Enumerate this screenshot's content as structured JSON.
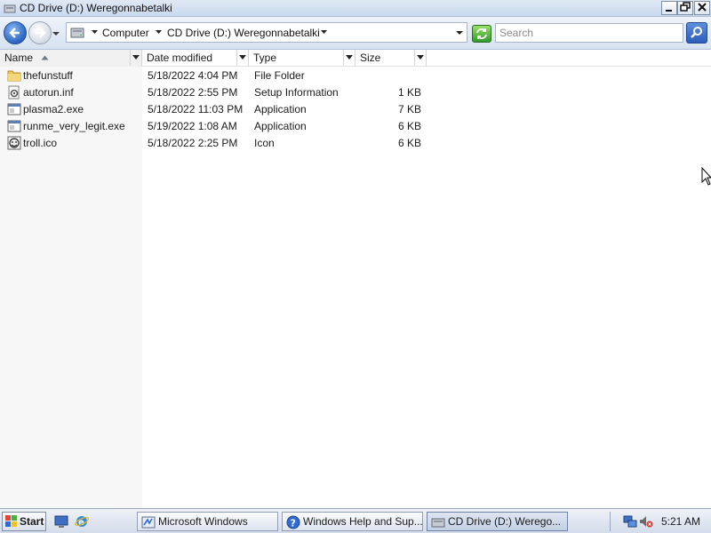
{
  "window": {
    "title": "CD Drive (D:) Weregonnabetalki"
  },
  "address_bar": {
    "crumbs": [
      "Computer",
      "CD Drive (D:) Weregonnabetalki"
    ]
  },
  "search": {
    "placeholder": "Search"
  },
  "columns": {
    "name": "Name",
    "date_modified": "Date modified",
    "type": "Type",
    "size": "Size"
  },
  "files": [
    {
      "name": "thefunstuff",
      "date": "5/18/2022 4:04 PM",
      "type": "File Folder",
      "size": "",
      "icon": "folder-icon"
    },
    {
      "name": "autorun.inf",
      "date": "5/18/2022 2:55 PM",
      "type": "Setup Information",
      "size": "1 KB",
      "icon": "setup-info-icon"
    },
    {
      "name": "plasma2.exe",
      "date": "5/18/2022 11:03 PM",
      "type": "Application",
      "size": "7 KB",
      "icon": "application-icon"
    },
    {
      "name": "runme_very_legit.exe",
      "date": "5/19/2022 1:08 AM",
      "type": "Application",
      "size": "6 KB",
      "icon": "application-icon"
    },
    {
      "name": "troll.ico",
      "date": "5/18/2022 2:25 PM",
      "type": "Icon",
      "size": "6 KB",
      "icon": "icon-file-icon"
    }
  ],
  "taskbar": {
    "start_label": "Start",
    "tasks": [
      {
        "label": "Microsoft Windows"
      },
      {
        "label": "Windows Help and Sup..."
      },
      {
        "label": "CD Drive (D:) Werego..."
      }
    ],
    "clock": "5:21 AM"
  },
  "colors": {
    "accent": "#2a64c3",
    "titlebar": "#dfe9f5",
    "taskbar": "#d4dceb"
  }
}
